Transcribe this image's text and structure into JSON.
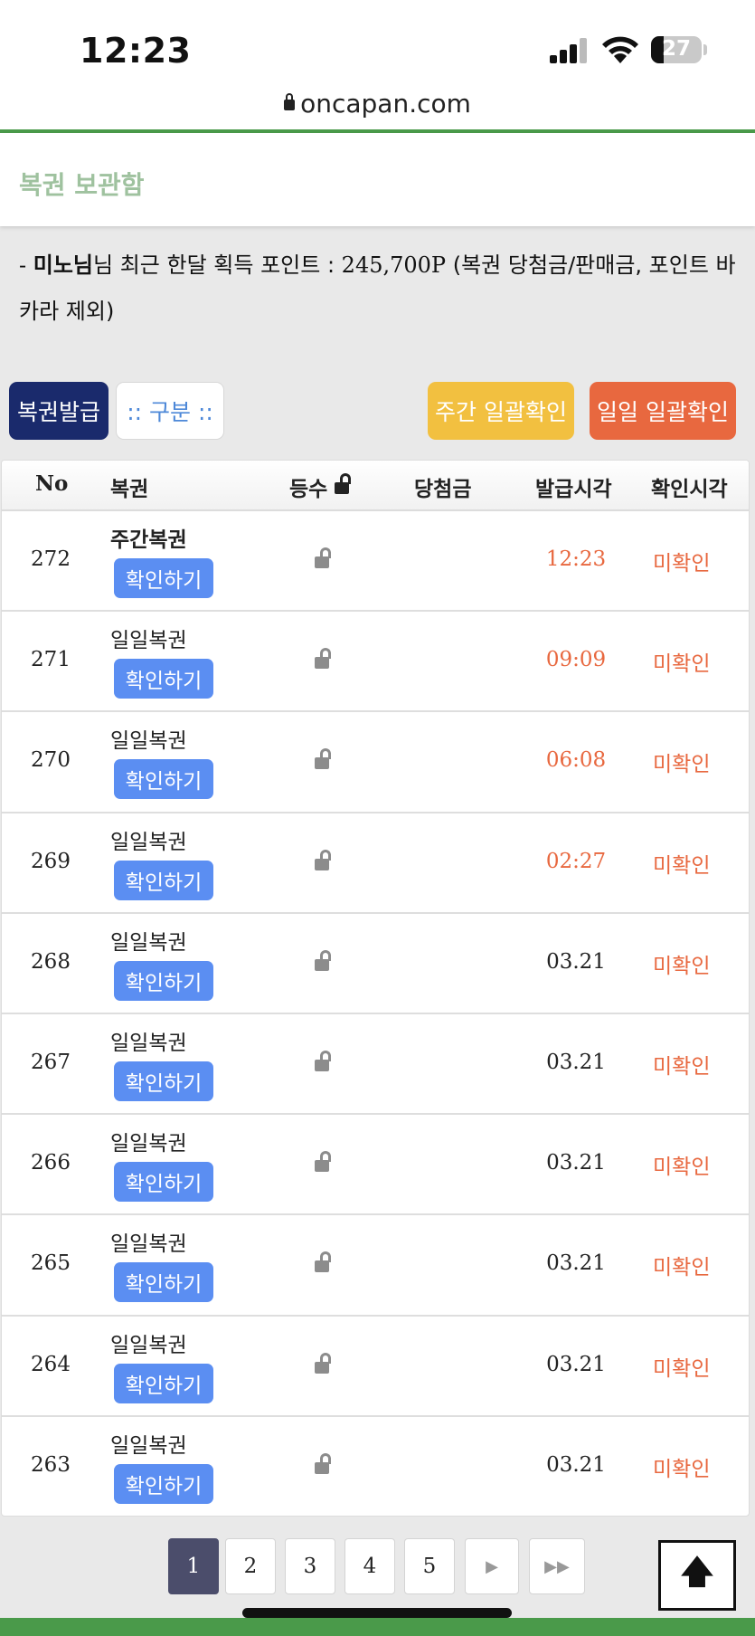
{
  "status_bar": {
    "time": "12:23",
    "battery": "27"
  },
  "browser": {
    "url": "oncapan.com"
  },
  "page": {
    "title": "복권 보관함"
  },
  "points": {
    "prefix": " - ",
    "user": "미노님",
    "text": "님 최근 한달 획득 포인트 : ",
    "value": "245,700P",
    "note": " (복권 당첨금/판매금, 포인트 바카라 제외)"
  },
  "toolbar": {
    "issue_label": "복권발급",
    "category_label": ":: 구분 ::",
    "weekly_confirm_label": "주간 일괄확인",
    "daily_confirm_label": "일일 일괄확인"
  },
  "table": {
    "headers": {
      "no": "No",
      "name": "복권",
      "grade": "등수",
      "prize": "당첨금",
      "issued": "발급시각",
      "checked": "확인시각"
    },
    "check_button_label": "확인하기",
    "rows": [
      {
        "no": "272",
        "name": "주간복권",
        "issued": "12:23",
        "checked": "미확인",
        "today": true,
        "weekly": true
      },
      {
        "no": "271",
        "name": "일일복권",
        "issued": "09:09",
        "checked": "미확인",
        "today": true
      },
      {
        "no": "270",
        "name": "일일복권",
        "issued": "06:08",
        "checked": "미확인",
        "today": true
      },
      {
        "no": "269",
        "name": "일일복권",
        "issued": "02:27",
        "checked": "미확인",
        "today": true
      },
      {
        "no": "268",
        "name": "일일복권",
        "issued": "03.21",
        "checked": "미확인"
      },
      {
        "no": "267",
        "name": "일일복권",
        "issued": "03.21",
        "checked": "미확인"
      },
      {
        "no": "266",
        "name": "일일복권",
        "issued": "03.21",
        "checked": "미확인"
      },
      {
        "no": "265",
        "name": "일일복권",
        "issued": "03.21",
        "checked": "미확인"
      },
      {
        "no": "264",
        "name": "일일복권",
        "issued": "03.21",
        "checked": "미확인"
      },
      {
        "no": "263",
        "name": "일일복권",
        "issued": "03.21",
        "checked": "미확인"
      }
    ]
  },
  "pagination": {
    "pages": [
      "1",
      "2",
      "3",
      "4",
      "5"
    ],
    "current": "1",
    "next_icon": "▶",
    "last_icon": "▶▶"
  },
  "scroll_top": {
    "icon": "🡅"
  }
}
